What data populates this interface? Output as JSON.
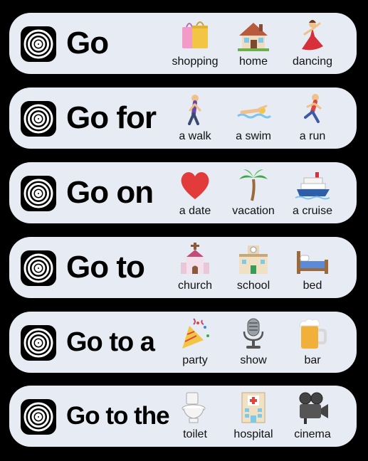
{
  "rows": [
    {
      "phrase": "Go",
      "items": [
        {
          "label": "shopping",
          "icon": "shopping-bags-icon"
        },
        {
          "label": "home",
          "icon": "house-icon"
        },
        {
          "label": "dancing",
          "icon": "dancer-icon"
        }
      ]
    },
    {
      "phrase": "Go for",
      "items": [
        {
          "label": "a walk",
          "icon": "person-walking-icon"
        },
        {
          "label": "a swim",
          "icon": "person-swimming-icon"
        },
        {
          "label": "a run",
          "icon": "person-running-icon"
        }
      ]
    },
    {
      "phrase": "Go on",
      "items": [
        {
          "label": "a date",
          "icon": "red-heart-icon"
        },
        {
          "label": "vacation",
          "icon": "palm-tree-icon"
        },
        {
          "label": "a cruise",
          "icon": "cruise-ship-icon"
        }
      ]
    },
    {
      "phrase": "Go to",
      "items": [
        {
          "label": "church",
          "icon": "church-icon"
        },
        {
          "label": "school",
          "icon": "school-icon"
        },
        {
          "label": "bed",
          "icon": "bed-icon"
        }
      ]
    },
    {
      "phrase": "Go to a",
      "items": [
        {
          "label": "party",
          "icon": "party-popper-icon"
        },
        {
          "label": "show",
          "icon": "microphone-icon"
        },
        {
          "label": "bar",
          "icon": "beer-mug-icon"
        }
      ]
    },
    {
      "phrase": "Go to the",
      "items": [
        {
          "label": "toilet",
          "icon": "toilet-icon"
        },
        {
          "label": "hospital",
          "icon": "hospital-icon"
        },
        {
          "label": "cinema",
          "icon": "movie-camera-icon"
        }
      ]
    }
  ],
  "colors": {
    "background": "#000000",
    "card": "#e7ebf3",
    "text": "#000000"
  }
}
